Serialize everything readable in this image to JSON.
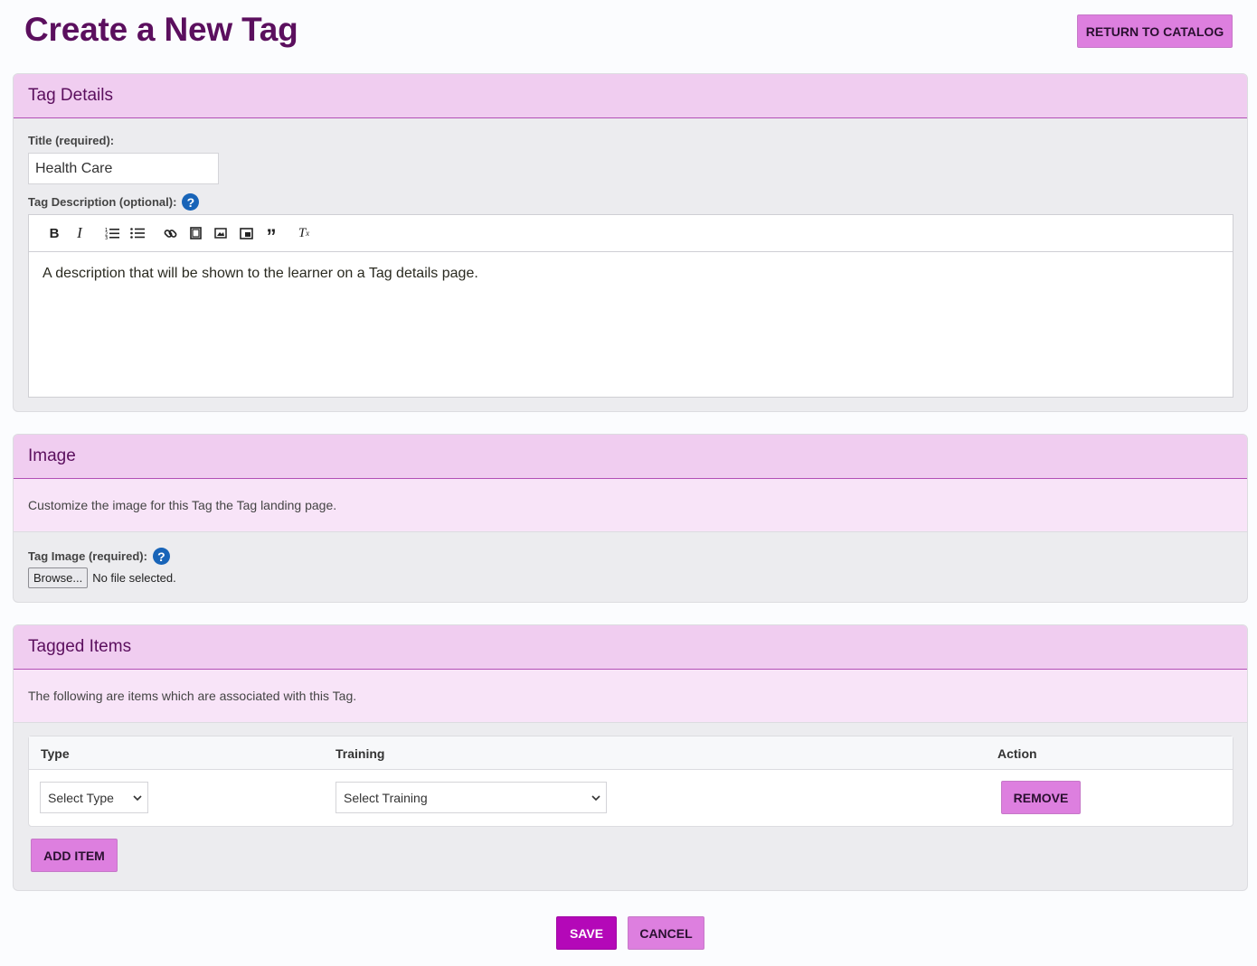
{
  "page": {
    "title": "Create a New Tag",
    "return_label": "RETURN TO CATALOG"
  },
  "details": {
    "header": "Tag Details",
    "title_label": "Title (required):",
    "title_value": "Health Care",
    "description_label": "Tag Description (optional):",
    "description_text": "A description that will be shown to the learner on a Tag details page.",
    "toolbar": {
      "bold": "B",
      "italic": "I",
      "ordered_list": "≡",
      "bullet_list": "☰",
      "link": "🔗",
      "video": "▦",
      "image": "▣",
      "embed": "▢",
      "quote": "❞",
      "clear_format": "Tx"
    }
  },
  "image": {
    "header": "Image",
    "subtitle": "Customize the image for this Tag the Tag landing page.",
    "field_label": "Tag Image (required):",
    "browse_label": "Browse...",
    "file_status": "No file selected."
  },
  "tagged": {
    "header": "Tagged Items",
    "subtitle": "The following are items which are associated with this Tag.",
    "columns": [
      "Type",
      "Training",
      "Action"
    ],
    "row": {
      "type_value": "Select Type",
      "training_value": "Select Training",
      "remove_label": "REMOVE"
    },
    "add_label": "ADD ITEM"
  },
  "footer": {
    "save_label": "SAVE",
    "cancel_label": "CANCEL"
  },
  "colors": {
    "accent": "#5b0f5e",
    "header_bg": "#f0cdf0",
    "button_bg": "#dd7fdf",
    "save_bg": "#b408b8",
    "help_icon": "#1864b8"
  }
}
